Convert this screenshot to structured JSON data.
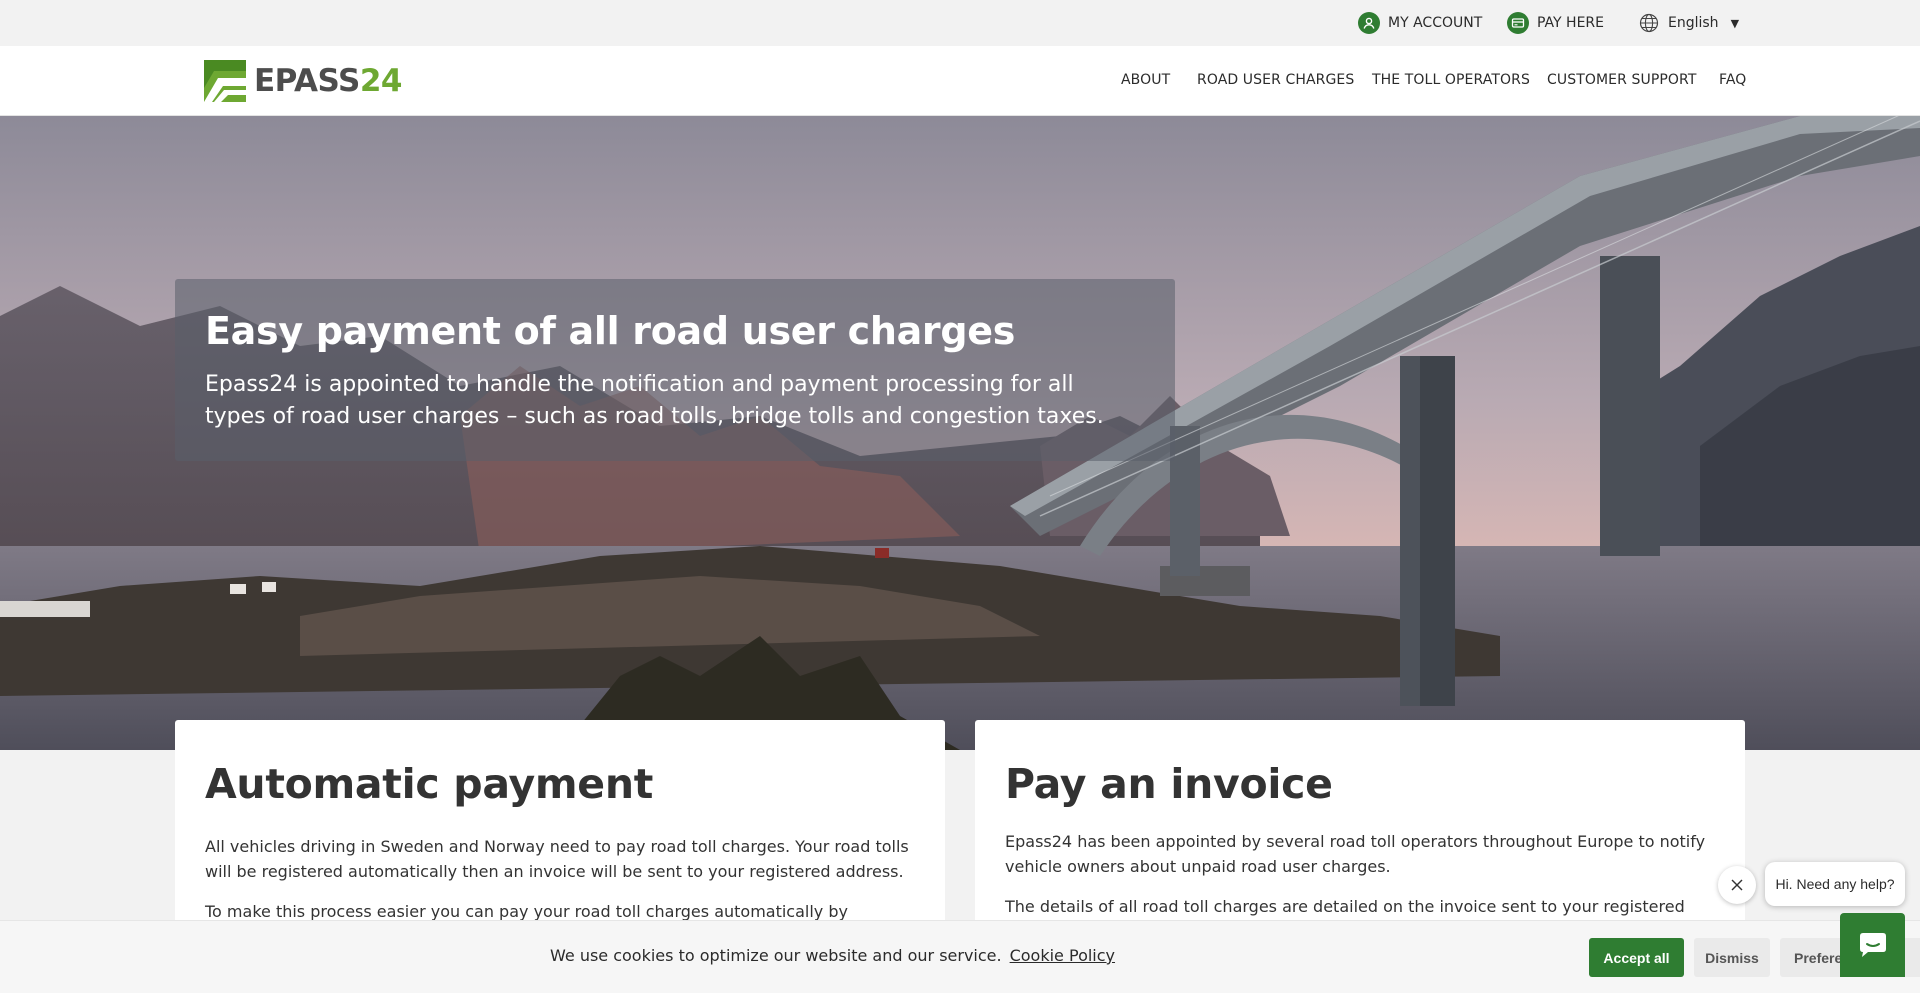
{
  "utility": {
    "my_account": "MY ACCOUNT",
    "pay_here": "PAY HERE",
    "language": "English"
  },
  "logo": {
    "part1": "EPASS",
    "part2": "24"
  },
  "nav": {
    "items": [
      "ABOUT",
      "ROAD USER CHARGES",
      "THE TOLL OPERATORS",
      "CUSTOMER SUPPORT",
      "FAQ"
    ]
  },
  "hero": {
    "title": "Easy payment of all road user charges",
    "subtitle": "Epass24 is appointed to handle the notification and payment processing for all types of road user charges – such as road tolls, bridge tolls and congestion taxes."
  },
  "cards": {
    "automatic": {
      "title": "Automatic payment",
      "p1": "All vehicles driving in Sweden and Norway need to pay road toll charges. Your road tolls will be registered automatically then an invoice will be sent to your registered address.",
      "p2": "To make this process easier you can pay your road toll charges automatically by registering for"
    },
    "invoice": {
      "title": "Pay an invoice",
      "p1": "Epass24 has been appointed by several road toll operators throughout Europe to notify vehicle owners about unpaid road user charges.",
      "p2": "The details of all road toll charges are detailed on the invoice sent to your registered address"
    }
  },
  "cookie": {
    "message": "We use cookies to optimize our website and our service.",
    "link": "Cookie Policy",
    "accept": "Accept all",
    "dismiss": "Dismiss",
    "preferences": "Preferences"
  },
  "chat": {
    "greeting": "Hi. Need any help?"
  },
  "colors": {
    "brand_green": "#2f7d32",
    "logo_green": "#6ea832"
  }
}
